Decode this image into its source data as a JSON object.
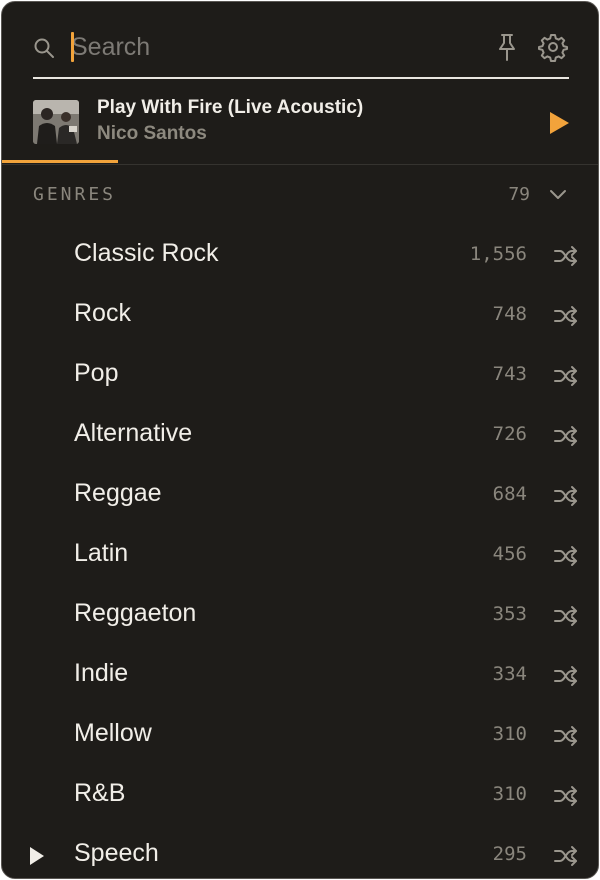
{
  "search": {
    "placeholder": "Search",
    "value": ""
  },
  "now_playing": {
    "title": "Play With Fire (Live Acoustic)",
    "artist": "Nico Santos",
    "progress": 0.2
  },
  "genres": {
    "title": "GENRES",
    "count": "79",
    "items": [
      {
        "name": "Classic Rock",
        "count": "1,556"
      },
      {
        "name": "Rock",
        "count": "748"
      },
      {
        "name": "Pop",
        "count": "743"
      },
      {
        "name": "Alternative",
        "count": "726"
      },
      {
        "name": "Reggae",
        "count": "684"
      },
      {
        "name": "Latin",
        "count": "456"
      },
      {
        "name": "Reggaeton",
        "count": "353"
      },
      {
        "name": "Indie",
        "count": "334"
      },
      {
        "name": "Mellow",
        "count": "310"
      },
      {
        "name": "R&B",
        "count": "310"
      },
      {
        "name": "Speech",
        "count": "295"
      }
    ]
  },
  "colors": {
    "accent": "#f2a33b",
    "background": "#1e1c19",
    "text": "#f1eee8",
    "muted": "#8a867d"
  },
  "icons": {
    "search": "search-icon",
    "pin": "pin-icon",
    "settings": "gear-icon",
    "play": "play-icon",
    "collapse": "chevron-down-icon",
    "shuffle": "shuffle-icon"
  }
}
